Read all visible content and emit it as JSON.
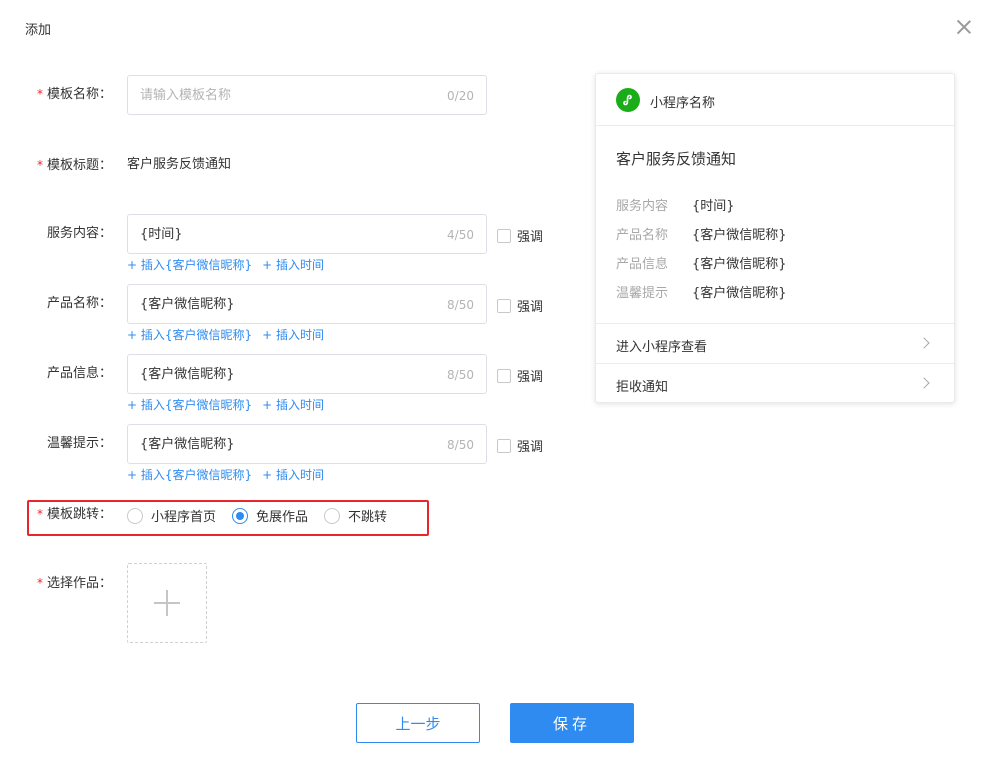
{
  "dialog": {
    "title": "添加"
  },
  "form": {
    "template_name": {
      "label": "模板名称：",
      "placeholder": "请输入模板名称",
      "count": "0/20"
    },
    "template_title": {
      "label": "模板标题：",
      "value": "客户服务反馈通知"
    },
    "fields": [
      {
        "label": "服务内容：",
        "value": "{时间}",
        "count": "4/50",
        "emphasis": "强调"
      },
      {
        "label": "产品名称：",
        "value": "{客户微信昵称}",
        "count": "8/50",
        "emphasis": "强调"
      },
      {
        "label": "产品信息：",
        "value": "{客户微信昵称}",
        "count": "8/50",
        "emphasis": "强调"
      },
      {
        "label": "温馨提示：",
        "value": "{客户微信昵称}",
        "count": "8/50",
        "emphasis": "强调"
      }
    ],
    "insert_links": {
      "nickname": "+ 插入{客户微信昵称}",
      "time": "+ 插入时间"
    },
    "jump": {
      "label": "模板跳转：",
      "options": [
        {
          "label": "小程序首页",
          "checked": false
        },
        {
          "label": "免展作品",
          "checked": true
        },
        {
          "label": "不跳转",
          "checked": false
        }
      ]
    },
    "select_work": {
      "label": "选择作品："
    },
    "required_mark": "*"
  },
  "buttons": {
    "prev": "上一步",
    "save": "保存"
  },
  "preview": {
    "app_name": "小程序名称",
    "title": "客户服务反馈通知",
    "rows": [
      {
        "key": "服务内容",
        "value": "{时间}"
      },
      {
        "key": "产品名称",
        "value": "{客户微信昵称}"
      },
      {
        "key": "产品信息",
        "value": "{客户微信昵称}"
      },
      {
        "key": "温馨提示",
        "value": "{客户微信昵称}"
      }
    ],
    "links": [
      "进入小程序查看",
      "拒收通知"
    ]
  },
  "colors": {
    "primary": "#2f8bf0",
    "required": "#f5222d",
    "highlight_border": "#e8262d",
    "miniprogram_green": "#1aad19"
  }
}
